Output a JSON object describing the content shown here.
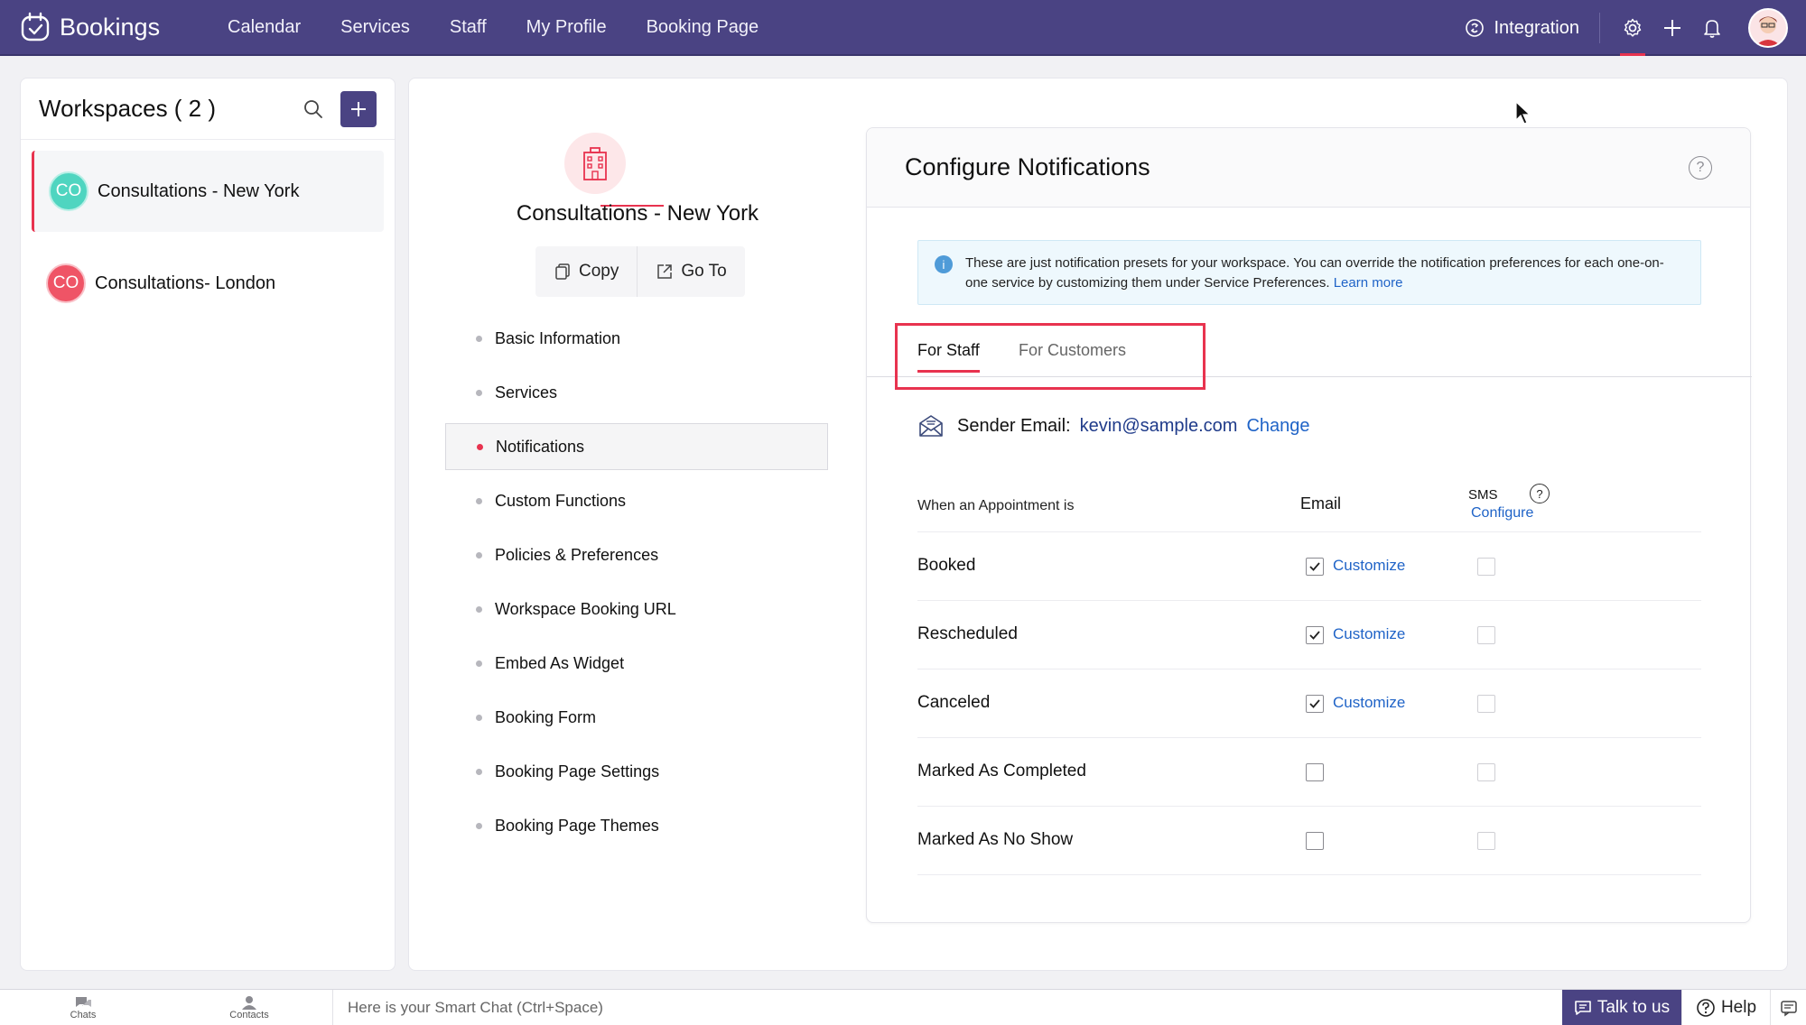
{
  "app": {
    "name": "Bookings"
  },
  "nav": {
    "items": [
      "Calendar",
      "Services",
      "Staff",
      "My Profile",
      "Booking Page"
    ]
  },
  "topright": {
    "integration": "Integration"
  },
  "workspaces": {
    "title": "Workspaces ( 2 )",
    "items": [
      {
        "badge": "CO",
        "name": "Consultations - New York",
        "color": "#4fd5c0",
        "active": true
      },
      {
        "badge": "CO",
        "name": "Consultations- London",
        "color": "#ef5466",
        "active": false
      }
    ]
  },
  "workspace": {
    "title": "Consultations - New York",
    "copy_label": "Copy",
    "goto_label": "Go To"
  },
  "menu": {
    "items": [
      "Basic Information",
      "Services",
      "Notifications",
      "Custom Functions",
      "Policies & Preferences",
      "Workspace Booking URL",
      "Embed As Widget",
      "Booking Form",
      "Booking Page Settings",
      "Booking Page Themes"
    ],
    "active": "Notifications"
  },
  "config": {
    "title": "Configure Notifications",
    "info_text": "These are just notification presets for your workspace. You can override the notification preferences for each one-on-one service by customizing them under Service Preferences.",
    "info_link": "Learn more",
    "tabs": [
      "For Staff",
      "For Customers"
    ],
    "sender_label": "Sender Email:",
    "sender_email": "kevin@sample.com",
    "sender_change": "Change",
    "col_when": "When an Appointment is",
    "col_email": "Email",
    "col_sms": "SMS",
    "sms_configure": "Configure",
    "customize_label": "Customize",
    "rows": [
      {
        "label": "Booked",
        "email": true,
        "sms": false
      },
      {
        "label": "Rescheduled",
        "email": true,
        "sms": false
      },
      {
        "label": "Canceled",
        "email": true,
        "sms": false
      },
      {
        "label": "Marked As Completed",
        "email": false,
        "sms": false
      },
      {
        "label": "Marked As No Show",
        "email": false,
        "sms": false
      }
    ]
  },
  "bottombar": {
    "chats": "Chats",
    "contacts": "Contacts",
    "smart_chat": "Here is your Smart Chat (Ctrl+Space)",
    "talk": "Talk to us",
    "help": "Help"
  }
}
